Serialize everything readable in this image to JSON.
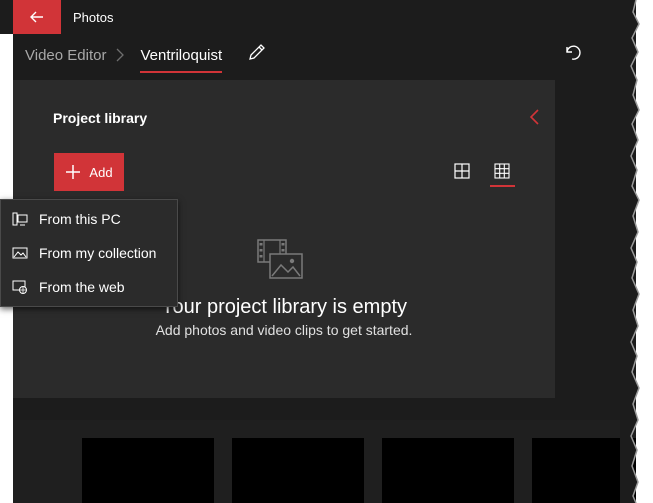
{
  "app": {
    "title": "Photos"
  },
  "breadcrumb": {
    "root": "Video Editor",
    "current": "Ventriloquist"
  },
  "library": {
    "title": "Project library",
    "add_label": "Add",
    "empty_title": "Your project library is empty",
    "empty_subtitle": "Add photos and video clips to get started."
  },
  "add_menu": {
    "items": [
      {
        "label": "From this PC",
        "icon": "computer-icon"
      },
      {
        "label": "From my collection",
        "icon": "collection-icon"
      },
      {
        "label": "From the web",
        "icon": "web-icon"
      }
    ]
  },
  "colors": {
    "accent": "#d13438",
    "background": "#1c1c1c",
    "panel": "#2b2b2b"
  }
}
